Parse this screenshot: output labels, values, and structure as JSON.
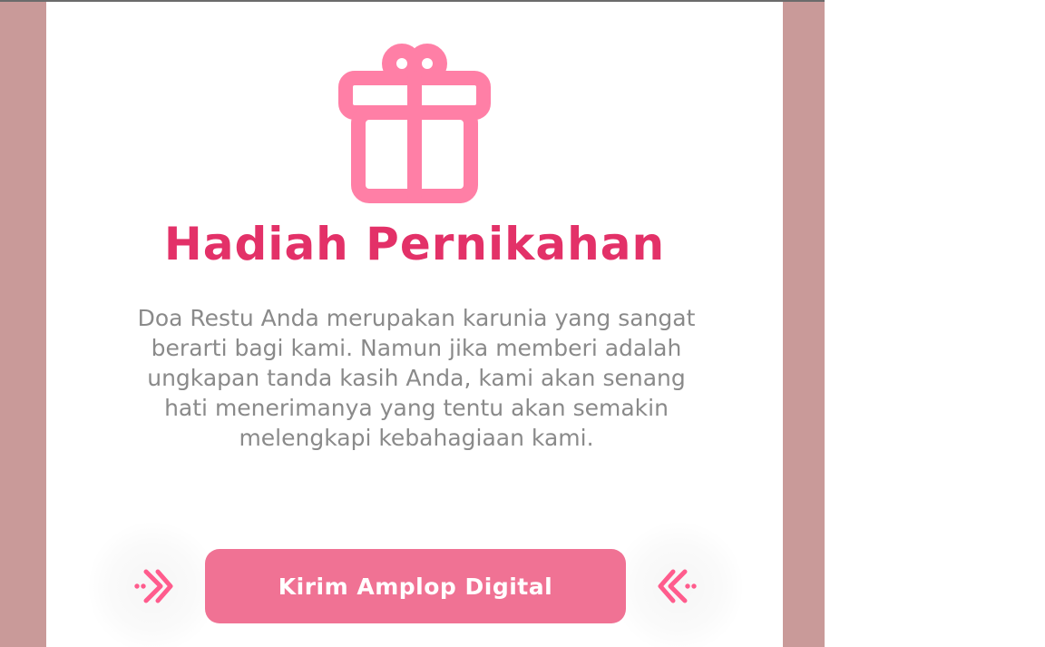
{
  "gift": {
    "icon": "gift-icon",
    "color": "#ff7fa6"
  },
  "section": {
    "title": "Hadiah Pernikahan",
    "message": "Doa Restu Anda merupakan karunia yang sangat berarti bagi kami. Namun jika memberi adalah ungkapan tanda kasih Anda, kami akan senang hati menerimanya yang tentu akan semakin melengkapi kebahagiaan kami."
  },
  "button": {
    "label": "Kirim Amplop Digital",
    "left_icon": "double-chevron-right-icon",
    "right_icon": "double-chevron-left-icon"
  },
  "colors": {
    "title": "#e33168",
    "button": "#f07294",
    "accent": "#ff5c8d",
    "side_band": "#c99a99",
    "message": "#8a8a8a"
  }
}
